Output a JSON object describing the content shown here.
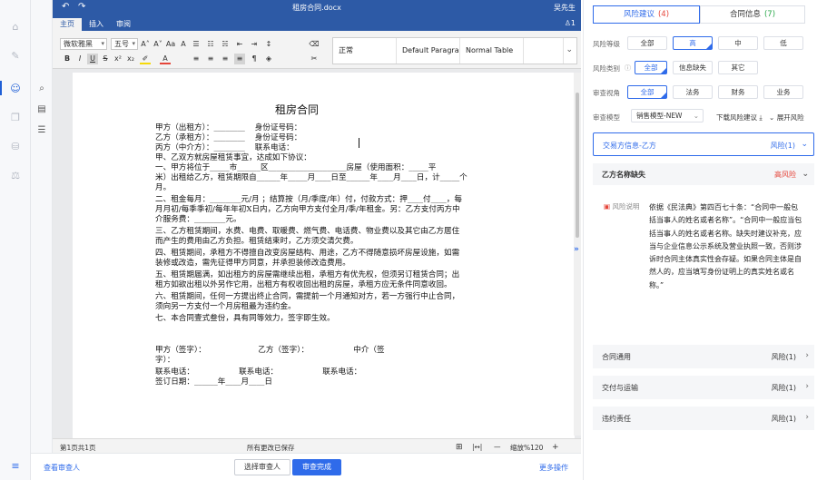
{
  "editor": {
    "doc_name": "租房合同.docx",
    "user": "吴先生",
    "tabs": [
      "主页",
      "插入",
      "审阅"
    ],
    "collab_count": "1",
    "font_name": "微软雅黑",
    "font_size": "五号",
    "styles": [
      "正常",
      "Default Paragra",
      "Normal Table"
    ]
  },
  "document": {
    "title": "租房合同",
    "lines": [
      "甲方（出租方）：________    身份证号码：",
      "乙方（承租方）：________    身份证号码：",
      "丙方（中介方）：________    联系电话：",
      "甲、乙双方就房屋租赁事宜，达成如下协议：",
      "一、甲方将位于_____市______区____________________房屋（使用面积：_____平",
      "米）出租给乙方，租赁期限自______年_____月____日至______年____月____日，计_____个",
      "月。",
      "二、租金每月：________元/月 ；结算按（月/季度/年）付，付款方式：押____付____，每",
      "月月初/每季季初/每年年初X日内，乙方向甲方支付全月/季/年租金。另：乙方支付丙方中",
      "介服务费：________元。",
      "三、乙方租赁期间，水费、电费、取暖费、燃气费、电话费、物业费以及其它由乙方居住",
      "而产生的费用由乙方负担。租赁结束时，乙方须交清欠费。",
      "四、租赁期间，承租方不得擅自改变房屋结构、用途，乙方不得随意损坏房屋设施，如需",
      "装修或改造，需先征得甲方同意，并承担装修改造费用。",
      "五、租赁期届满，如出租方的房屋需继续出租，承租方有优先权，但须另订租赁合同；出",
      "租方如欲出租以外另作它用，出租方有权收回出租的房屋，承租方应无条件同意收回。",
      "六、租赁期间，任何一方提出终止合同，需提前一个月通知对方，若一方强行中止合同，",
      "须向另一方支付一个月房租最为违约金。",
      "七、本合同壹式叁份，具有同等效力，签字即生效。",
      "",
      "甲方（签字）：                     乙方（签字）：                  中介（签",
      "字）：",
      "联系电话：                  联系电话：                  联系电话：",
      "签订日期：______年____月____日"
    ]
  },
  "status": {
    "page": "第1页共1页",
    "saved": "所有更改已保存",
    "zoom": "缩放%120"
  },
  "bottom": {
    "view_reviewers": "查看审查人",
    "select_reviewer": "选择审查人",
    "finish": "审查完成",
    "more": "更多操作"
  },
  "panel": {
    "tab_risk": "风险建议",
    "tab_risk_count": "(4)",
    "tab_info": "合同信息",
    "tab_info_count": "(7)",
    "level_label": "风险等级",
    "levels": [
      "全部",
      "高",
      "中",
      "低"
    ],
    "type_label": "风险类别",
    "types": [
      "全部",
      "信息缺失",
      "其它"
    ],
    "view_label": "审查视角",
    "views": [
      "全部",
      "法务",
      "财务",
      "业务"
    ],
    "model_label": "审查模型",
    "model_value": "销售模型-NEW",
    "download": "下载风险建议",
    "expand_all": "展开风险",
    "section1_title": "交易方信息-乙方",
    "section1_risk": "风险(1)",
    "item_title": "乙方名称缺失",
    "item_level": "高风险",
    "explain_label": "风险说明",
    "explain_text": "依据《民法典》第四百七十条：“合同中一般包括当事人的姓名或者名称”。“合同中一般应当包括当事人的姓名或者名称。缺失时建议补充，应当与企业信息公示系统及营业执照一致，否则涉诉时合同主体真实性会存疑。如果合同主体是自然人的，应当填写身份证明上的真实姓名或名称。”",
    "sections": [
      {
        "title": "合同通用",
        "risk": "风险(1)"
      },
      {
        "title": "交付与运输",
        "risk": "风险(1)"
      },
      {
        "title": "违约责任",
        "risk": "风险(1)"
      }
    ],
    "colors": {
      "accent": "#2f6bea",
      "high": "#e5453a",
      "ok": "#2aa84a"
    }
  }
}
